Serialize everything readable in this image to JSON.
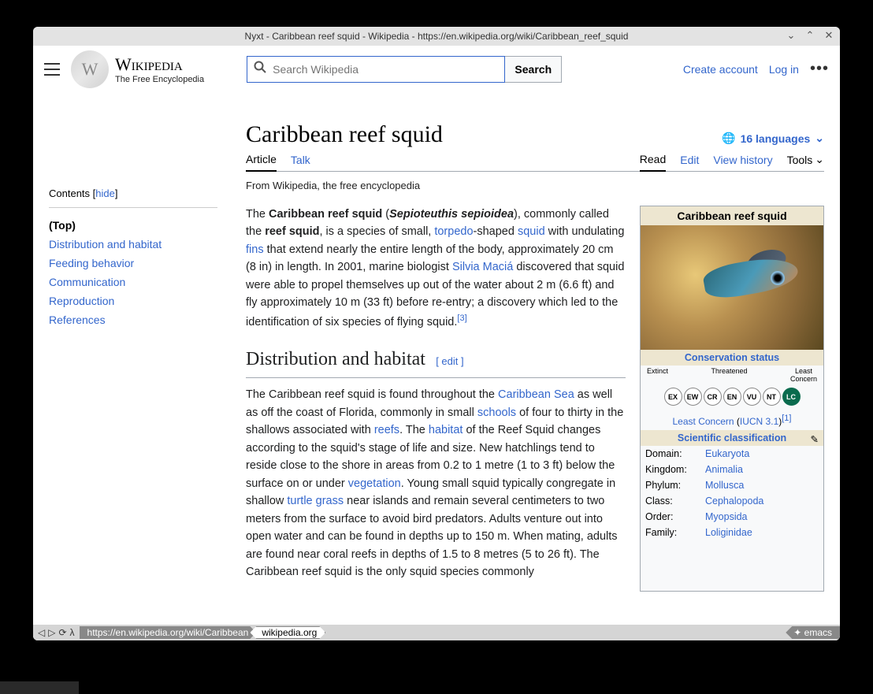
{
  "window": {
    "title": "Nyxt - Caribbean reef squid - Wikipedia - https://en.wikipedia.org/wiki/Caribbean_reef_squid"
  },
  "logo": {
    "title": "Wikipedia",
    "subtitle": "The Free Encyclopedia"
  },
  "search": {
    "placeholder": "Search Wikipedia",
    "button": "Search"
  },
  "header_links": {
    "create": "Create account",
    "login": "Log in"
  },
  "toc": {
    "label": "Contents",
    "hide": "hide",
    "items": [
      "(Top)",
      "Distribution and habitat",
      "Feeding behavior",
      "Communication",
      "Reproduction",
      "References"
    ]
  },
  "page": {
    "title": "Caribbean reef squid",
    "languages": "16 languages",
    "subline": "From Wikipedia, the free encyclopedia"
  },
  "tabs": {
    "article": "Article",
    "talk": "Talk",
    "read": "Read",
    "edit": "Edit",
    "history": "View history",
    "tools": "Tools"
  },
  "para1": {
    "t1": "The ",
    "b1": "Caribbean reef squid",
    "t2": " (",
    "bi1": "Sepioteuthis sepioidea",
    "t3": "), commonly called the ",
    "b2": "reef squid",
    "t4": ", is a species of small, ",
    "l1": "torpedo",
    "t5": "-shaped ",
    "l2": "squid",
    "t6": " with undulating ",
    "l3": "fins",
    "t7": " that extend nearly the entire length of the body, approximately 20 cm (8 in) in length. In 2001, marine biologist ",
    "l4": "Silvia Maciá",
    "t8": " discovered that squid were able to propel themselves up out of the water about 2 m (6.6 ft) and fly approximately 10 m (33 ft) before re-entry; a discovery which led to the identification of six species of flying squid.",
    "ref": "[3]"
  },
  "section1": {
    "title": "Distribution and habitat",
    "edit": "edit"
  },
  "para2": {
    "t1": "The Caribbean reef squid is found throughout the ",
    "l1": "Caribbean Sea",
    "t2": " as well as off the coast of Florida, commonly in small ",
    "l2": "schools",
    "t3": " of four to thirty in the shallows associated with ",
    "l3": "reefs",
    "t4": ". The ",
    "l4": "habitat",
    "t5": " of the Reef Squid changes according to the squid's stage of life and size. New hatchlings tend to reside close to the shore in areas from 0.2 to 1 metre (1 to 3 ft) below the surface on or under ",
    "l5": "vegetation",
    "t6": ". Young small squid typically congregate in shallow ",
    "l6": "turtle grass",
    "t7": " near islands and remain several centimeters to two meters from the surface to avoid bird predators. Adults venture out into open water and can be found in depths up to 150 m. When mating, adults are found near coral reefs in depths of 1.5 to 8 metres (5 to 26 ft). The Caribbean reef squid is the only squid species commonly"
  },
  "infobox": {
    "title": "Caribbean reef squid",
    "status_hdr": "Conservation status",
    "iucn_labels": {
      "ex": "Extinct",
      "th": "Threatened",
      "lc": "Least\nConcern"
    },
    "iucn": [
      "EX",
      "EW",
      "CR",
      "EN",
      "VU",
      "NT",
      "LC"
    ],
    "status_text": "Least Concern",
    "iucn_ver": "IUCN 3.1",
    "ref": "[1]",
    "class_hdr": "Scientific classification",
    "taxa": [
      {
        "label": "Domain:",
        "value": "Eukaryota"
      },
      {
        "label": "Kingdom:",
        "value": "Animalia"
      },
      {
        "label": "Phylum:",
        "value": "Mollusca"
      },
      {
        "label": "Class:",
        "value": "Cephalopoda"
      },
      {
        "label": "Order:",
        "value": "Myopsida"
      },
      {
        "label": "Family:",
        "value": "Loliginidae"
      }
    ]
  },
  "bottombar": {
    "url": "https://en.wikipedia.org/wiki/Caribbean",
    "domain": "wikipedia.org",
    "right": "✦ emacs"
  }
}
